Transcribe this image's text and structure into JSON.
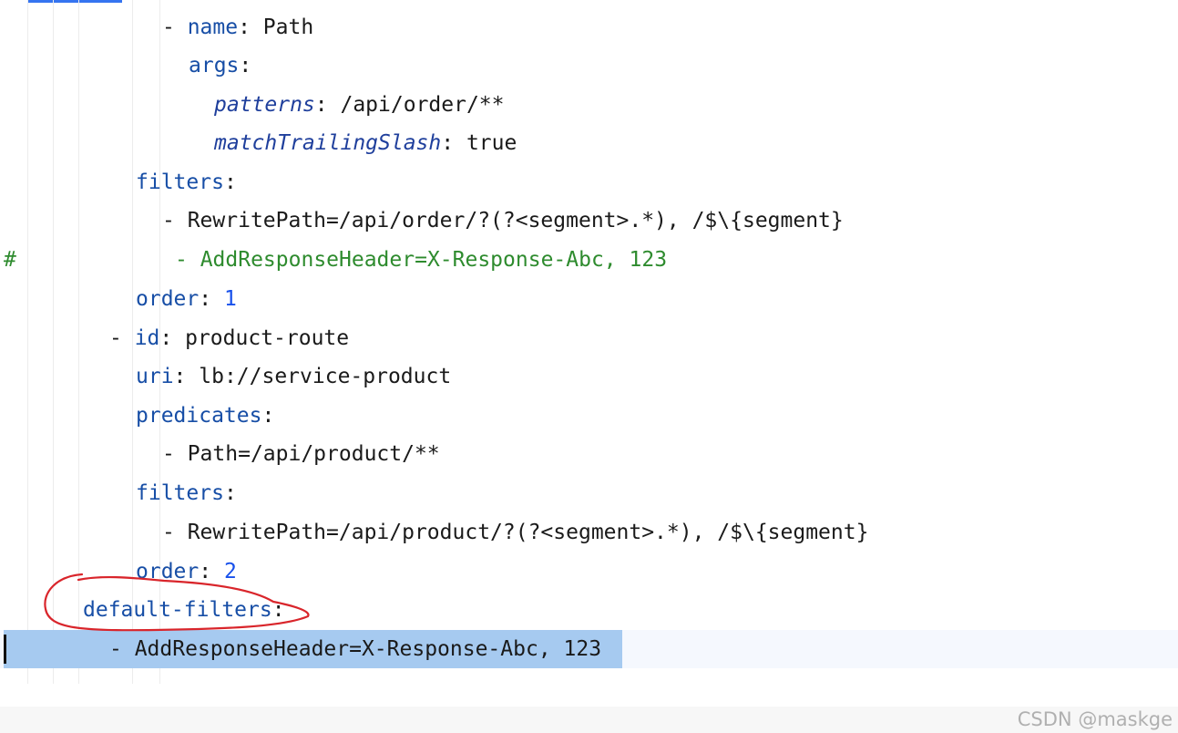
{
  "editor": {
    "lines": [
      {
        "dash": "- ",
        "key": "name",
        "sep": ": ",
        "value": "Path"
      },
      {
        "key": "args",
        "sep": ":"
      },
      {
        "key": "patterns",
        "sep": ": ",
        "value": "/api/order/**"
      },
      {
        "key": "matchTrailingSlash",
        "sep": ": ",
        "value": "true"
      },
      {
        "key": "filters",
        "sep": ":"
      },
      {
        "dash": "- ",
        "value": "RewritePath=/api/order/?(?<segment>.*), /$\\{segment}"
      },
      {
        "hash": "#",
        "comment": "- AddResponseHeader=X-Response-Abc, 123"
      },
      {
        "key": "order",
        "sep": ": ",
        "value": "1"
      },
      {
        "dash": "- ",
        "key": "id",
        "sep": ": ",
        "value": "product-route"
      },
      {
        "key": "uri",
        "sep": ": ",
        "value": "lb://service-product"
      },
      {
        "key": "predicates",
        "sep": ":"
      },
      {
        "dash": "- ",
        "value": "Path=/api/product/**"
      },
      {
        "key": "filters",
        "sep": ":"
      },
      {
        "dash": "- ",
        "value": "RewritePath=/api/product/?(?<segment>.*), /$\\{segment}"
      },
      {
        "key": "order",
        "sep": ": ",
        "value": "2"
      },
      {
        "key": "default-filters",
        "sep": ":"
      },
      {
        "dash": "- ",
        "value": "AddResponseHeader=X-Response-Abc, 123"
      }
    ]
  },
  "annotation": {
    "color": "#d9252b"
  },
  "selection": {
    "color": "#a6caf0"
  },
  "watermark": {
    "text": "CSDN @maskge"
  }
}
